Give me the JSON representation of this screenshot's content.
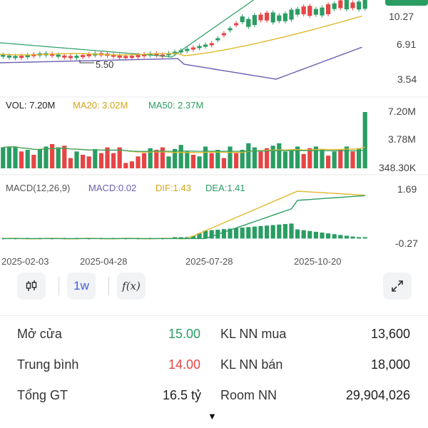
{
  "price_axis": [
    "10.27",
    "6.91",
    "3.54"
  ],
  "price_annotation": "5.50",
  "volume": {
    "legend_vol": "VOL: 7.20M",
    "legend_ma20": "MA20: 3.02M",
    "legend_ma50": "MA50: 2.37M",
    "axis": [
      "7.20M",
      "3.78M",
      "348.30K"
    ]
  },
  "macd": {
    "legend_name": "MACD(12,26,9)",
    "legend_macd": "MACD:0.02",
    "legend_dif": "DIF:1.43",
    "legend_dea": "DEA:1.41",
    "axis": [
      "1.69",
      "-0.27"
    ]
  },
  "x_axis": [
    "2025-02-03",
    "2025-04-28",
    "2025-07-28",
    "2025-10-20"
  ],
  "toolbar": {
    "candle_icon": "candlestick-icon",
    "interval_label": "1w",
    "indicator_label": "f(x)",
    "expand_icon": "expand-icon"
  },
  "stats": {
    "open_label": "Mở cửa",
    "open_value": "15.00",
    "avg_label": "Trung bình",
    "avg_value": "14.00",
    "total_label": "Tổng GT",
    "total_value": "16.5 tỷ",
    "foreign_buy_label": "KL NN mua",
    "foreign_buy_value": "13,600",
    "foreign_sell_label": "KL NN bán",
    "foreign_sell_value": "18,000",
    "room_label": "Room NN",
    "room_value": "29,904,026"
  },
  "colors": {
    "up": "#2a9d63",
    "down": "#e64545",
    "ma_yellow": "#e0b82c",
    "ma_purple": "#6b5fb0",
    "ma_green": "#2a9d63",
    "accent": "#3f5bd9"
  },
  "chart_data": {
    "type": "bar",
    "x": [
      "2025-02-03",
      "2025-04-28",
      "2025-07-28",
      "2025-10-20"
    ],
    "series": [
      {
        "name": "VOL",
        "values": [
          7.2
        ]
      },
      {
        "name": "MA20",
        "values": [
          3.02
        ]
      },
      {
        "name": "MA50",
        "values": [
          2.37
        ]
      }
    ],
    "volume_bars": [
      2.9,
      3.0,
      3.0,
      2.4,
      2.6,
      2.0,
      2.7,
      3.0,
      3.3,
      2.9,
      3.1,
      1.6,
      2.4,
      2.0,
      1.8,
      2.7,
      2.2,
      2.9,
      2.2,
      2.9,
      1.0,
      1.2,
      1.8,
      2.2,
      2.8,
      2.6,
      2.9,
      1.8,
      2.7,
      3.2,
      2.4,
      2.0,
      1.8,
      3.0,
      2.2,
      2.6,
      1.6,
      3.0,
      2.2,
      2.6,
      3.4,
      2.9,
      2.4,
      2.8,
      3.1,
      3.4,
      2.4,
      2.6,
      3.0,
      2.1,
      2.8,
      3.0,
      2.6,
      1.9,
      2.4,
      2.6,
      3.0,
      2.4,
      2.8,
      7.2
    ],
    "volume_dirs": [
      1,
      1,
      1,
      -1,
      1,
      -1,
      1,
      1,
      -1,
      1,
      -1,
      -1,
      1,
      -1,
      -1,
      1,
      -1,
      -1,
      -1,
      -1,
      -1,
      -1,
      -1,
      -1,
      1,
      -1,
      -1,
      1,
      1,
      1,
      1,
      -1,
      1,
      1,
      -1,
      1,
      -1,
      1,
      -1,
      1,
      1,
      1,
      -1,
      -1,
      1,
      1,
      1,
      1,
      1,
      -1,
      -1,
      1,
      1,
      -1,
      1,
      -1,
      1,
      -1,
      1,
      1
    ],
    "ylim": [
      0.3483,
      7.2
    ],
    "macd_ylim": [
      -0.27,
      1.69
    ],
    "price_ylim": [
      3.54,
      10.27
    ]
  }
}
